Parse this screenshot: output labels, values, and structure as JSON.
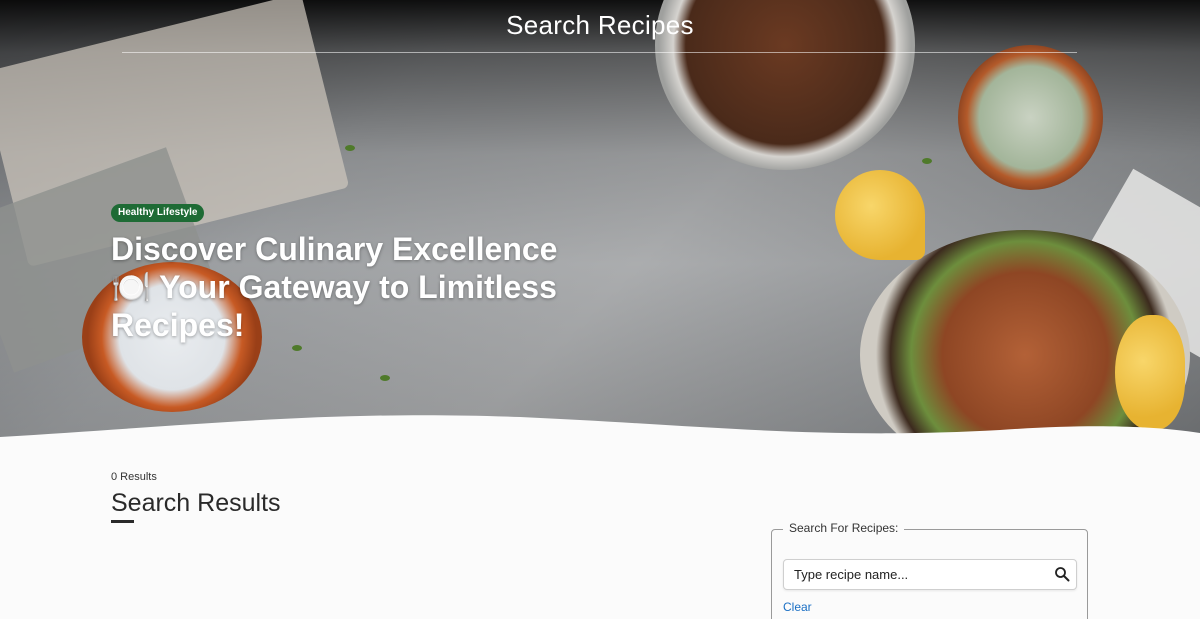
{
  "header": {
    "title": "Search Recipes"
  },
  "hero": {
    "badge": "Healthy Lifestyle",
    "headline": "Discover Culinary Excellence 🍽️ Your Gateway to Limitless Recipes!"
  },
  "results": {
    "count_label": "0 Results",
    "title": "Search Results"
  },
  "search": {
    "legend": "Search For Recipes:",
    "placeholder": "Type recipe name...",
    "value": "",
    "clear_label": "Clear",
    "icon": "search-icon"
  },
  "colors": {
    "badge_bg": "#1e6b35",
    "link": "#1a6fc4",
    "page_bg": "#fbfbfb"
  }
}
